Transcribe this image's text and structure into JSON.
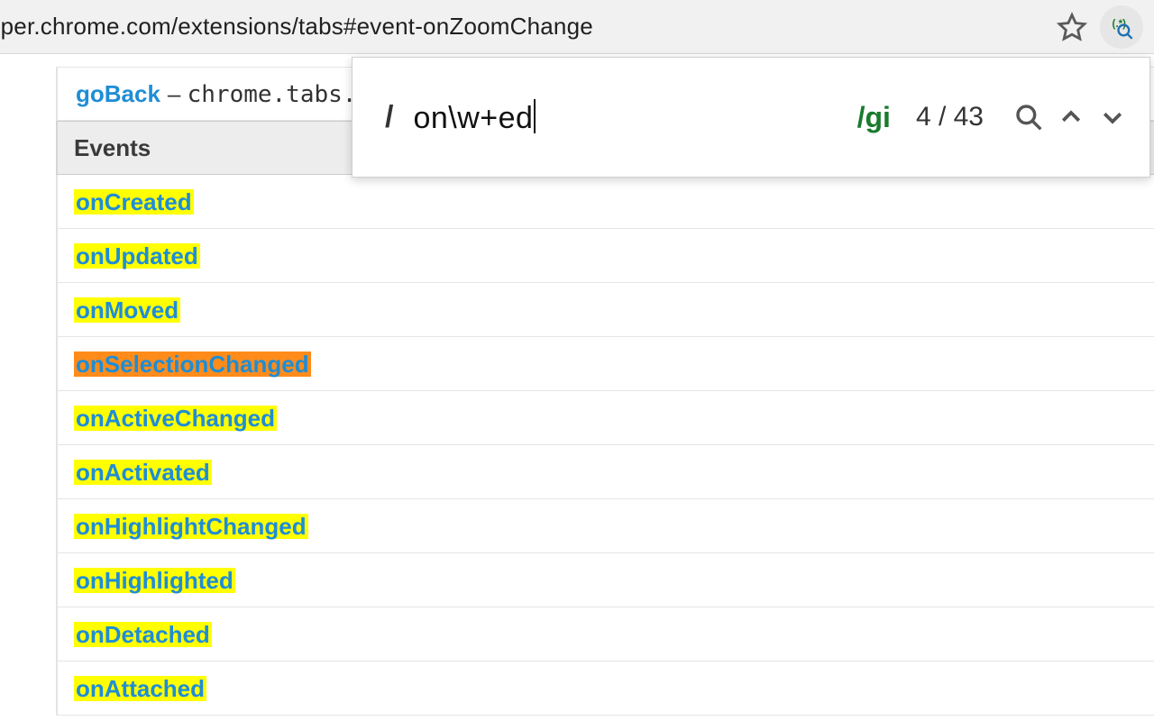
{
  "addressbar": {
    "url": "loper.chrome.com/extensions/tabs#event-onZoomChange"
  },
  "goback": {
    "link": "goBack",
    "after_dash": "– ",
    "after_code": "chrome.tabs."
  },
  "events_header": "Events",
  "events": [
    {
      "label": "onCreated",
      "active": false
    },
    {
      "label": "onUpdated",
      "active": false
    },
    {
      "label": "onMoved",
      "active": false
    },
    {
      "label": "onSelectionChanged",
      "active": true
    },
    {
      "label": "onActiveChanged",
      "active": false
    },
    {
      "label": "onActivated",
      "active": false
    },
    {
      "label": "onHighlightChanged",
      "active": false
    },
    {
      "label": "onHighlighted",
      "active": false
    },
    {
      "label": "onDetached",
      "active": false
    },
    {
      "label": "onAttached",
      "active": false
    }
  ],
  "search": {
    "open_slash": "/",
    "pattern": "on\\w+ed",
    "flags": "/gi",
    "count": "4 / 43"
  }
}
